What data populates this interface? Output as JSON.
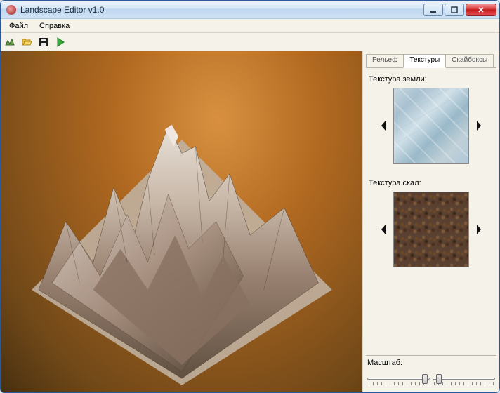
{
  "window": {
    "title": "Landscape Editor v1.0"
  },
  "menu": {
    "file": "Файл",
    "help": "Справка"
  },
  "toolbar_icons": {
    "new": "new-icon",
    "open": "open-icon",
    "save": "save-icon",
    "play": "play-icon"
  },
  "tabs": {
    "terrain": "Рельеф",
    "textures": "Текстуры",
    "skyboxes": "Скайбоксы",
    "active": "textures"
  },
  "textures": {
    "land_label": "Текстура земли:",
    "rock_label": "Текстура скал:"
  },
  "scale": {
    "label": "Масштаб:"
  },
  "sliders": {
    "s1": 0.95,
    "s2": 0.1
  }
}
